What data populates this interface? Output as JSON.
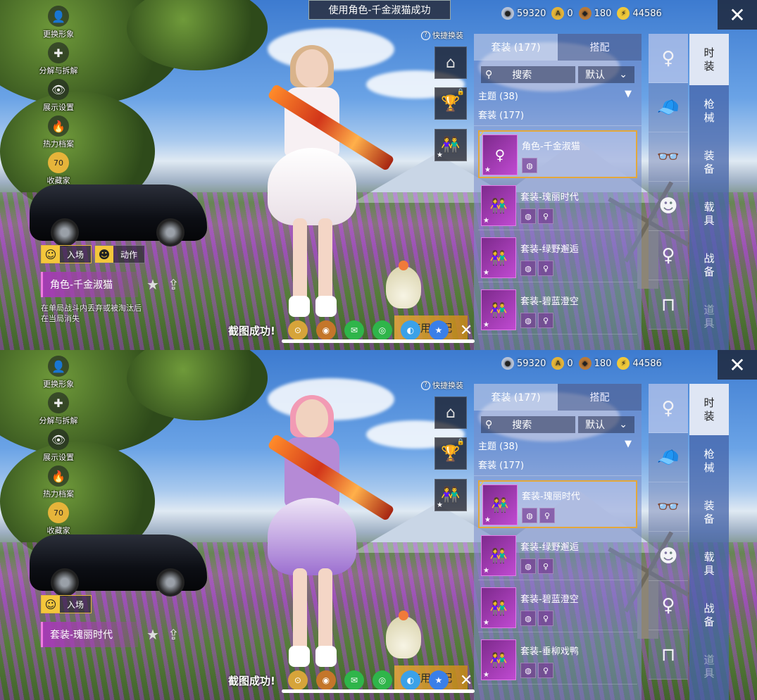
{
  "shots": [
    {
      "banner": "使用角色-千金淑猫成功",
      "left_menu": [
        "更换形象",
        "分解与拆解",
        "展示设置",
        "热力档案",
        "收藏家"
      ],
      "collector_badge": "70",
      "actions": [
        "入场",
        "动作"
      ],
      "outfit_name": "角色-千金淑猫",
      "note_line1": "在单局战斗内丢弃或被淘汰后",
      "note_line2": "在当局消失",
      "selected_index": 0,
      "items": [
        {
          "name": "角色-千金淑猫",
          "icon": "♀"
        },
        {
          "name": "套装-瑰丽时代",
          "icon": "👫"
        },
        {
          "name": "套装-绿野邂逅",
          "icon": "👫"
        },
        {
          "name": "套装-碧蓝澄空",
          "icon": "👫"
        }
      ],
      "active_category": 0
    },
    {
      "banner": "",
      "left_menu": [
        "更换形象",
        "分解与拆解",
        "展示设置",
        "热力档案",
        "收藏家"
      ],
      "collector_badge": "70",
      "actions": [
        "入场"
      ],
      "outfit_name": "套装-瑰丽时代",
      "note_line1": "",
      "note_line2": "",
      "selected_index": 0,
      "items": [
        {
          "name": "套装-瑰丽时代",
          "icon": "👫"
        },
        {
          "name": "套装-绿野邂逅",
          "icon": "👫"
        },
        {
          "name": "套装-碧蓝澄空",
          "icon": "👫"
        },
        {
          "name": "套装-垂柳戏鸭",
          "icon": "👫"
        }
      ],
      "active_category": 0
    }
  ],
  "currencies": {
    "silver": "59320",
    "gold": "0",
    "bronze": "180",
    "energy": "44586"
  },
  "quick_switch": "快捷换装",
  "tabs": {
    "suits": "套装 (177)",
    "match": "搭配"
  },
  "search": {
    "label": "搜索",
    "sort": "默认"
  },
  "theme_label": "主题 (38)",
  "set_label": "套装 (177)",
  "side_tabs": [
    "时\n装",
    "枪\n械",
    "装\n备",
    "载\n具",
    "战\n备",
    "道\n具"
  ],
  "share": {
    "text": "截图成功!",
    "use_button": "使用搭配"
  }
}
